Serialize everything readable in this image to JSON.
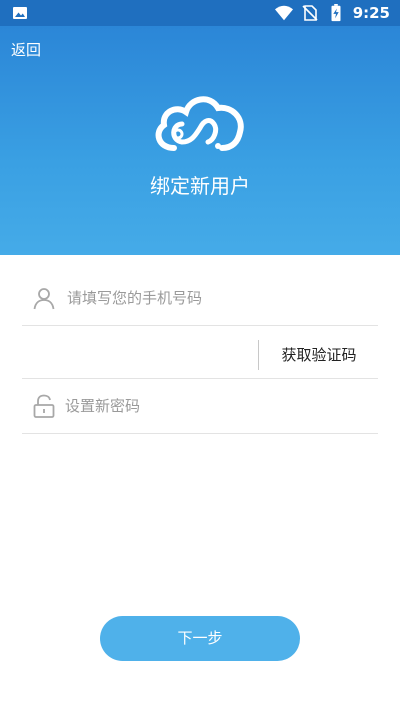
{
  "status_bar": {
    "time": "9:25",
    "icons": [
      "image-icon",
      "wifi-icon",
      "no-sim-icon",
      "battery-charging-icon"
    ]
  },
  "header": {
    "back_label": "返回",
    "title": "绑定新用户",
    "logo_icon": "cloud-logo-icon"
  },
  "form": {
    "phone": {
      "placeholder": "请填写您的手机号码",
      "value": "",
      "icon": "user-icon"
    },
    "code": {
      "placeholder": "",
      "value": "",
      "button_label": "获取验证码"
    },
    "password": {
      "placeholder": "设置新密码",
      "value": "",
      "icon": "lock-icon"
    }
  },
  "actions": {
    "next_label": "下一步"
  },
  "colors": {
    "status_bar": "#1f6fbf",
    "header_top": "#2b86d7",
    "header_bottom": "#45abe8",
    "button": "#4fb1ea"
  }
}
